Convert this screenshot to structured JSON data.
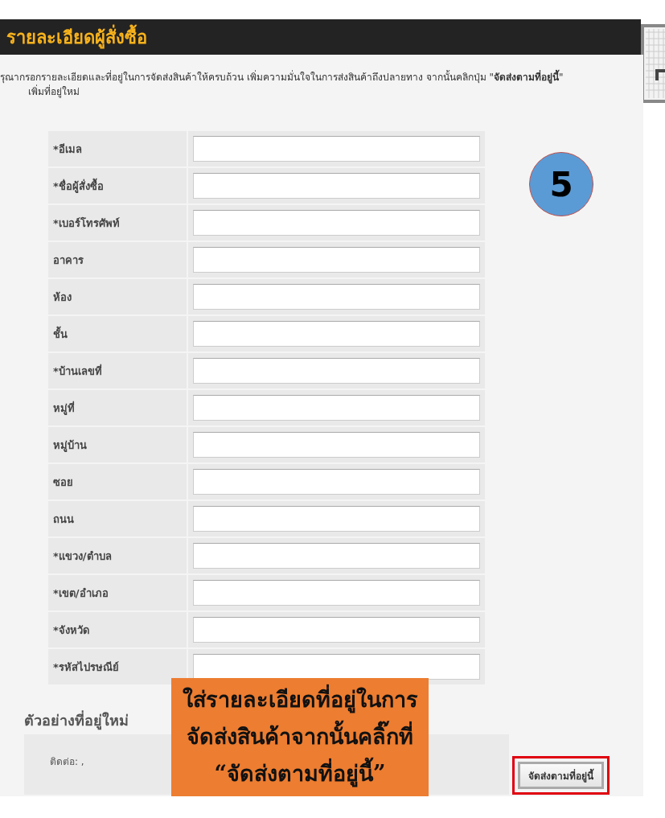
{
  "header": {
    "title": "รายละเอียดผู้สั่งซื้อ"
  },
  "instructions": [
    "รุณากรอกรายละเอียดและที่อยู่ในการจัดส่งสินค้าให้ครบถ้วน เพิ่มความมั่นใจในการส่งสินค้าถึงปลายทาง จากนั้นคลิกปุ่ม \"**จัดส่งตามที่อยู่นี้**\"",
    "เพิ่มที่อยู่ใหม่"
  ],
  "form": {
    "fields": [
      {
        "label": "*อีเมล"
      },
      {
        "label": "*ชื่อผู้สั่งซื้อ"
      },
      {
        "label": "*เบอร์โทรศัพท์"
      },
      {
        "label": "อาคาร"
      },
      {
        "label": "ห้อง"
      },
      {
        "label": "ชั้น"
      },
      {
        "label": "*บ้านเลขที่"
      },
      {
        "label": "หมู่ที่"
      },
      {
        "label": "หมู่บ้าน"
      },
      {
        "label": "ซอย"
      },
      {
        "label": "ถนน"
      },
      {
        "label": "*แขวง/ตำบล"
      },
      {
        "label": "*เขต/อำเภอ"
      },
      {
        "label": "*จังหวัด"
      },
      {
        "label": "*รหัสไปรษณีย์"
      }
    ]
  },
  "step_badge": "5",
  "callout": {
    "lines": [
      "ใส่รายละเอียดที่อยู่ในการ",
      "จัดส่งสินค้าจากนั้นคลิ๊กที่",
      "“จัดส่งตามที่อยู่นี้”"
    ]
  },
  "sample": {
    "title": "ตัวอย่างที่อยู่ใหม่",
    "contact": "ติดต่อ: ,",
    "button": "จัดส่งตามที่อยู่นี้",
    "button_highlighted": true
  }
}
